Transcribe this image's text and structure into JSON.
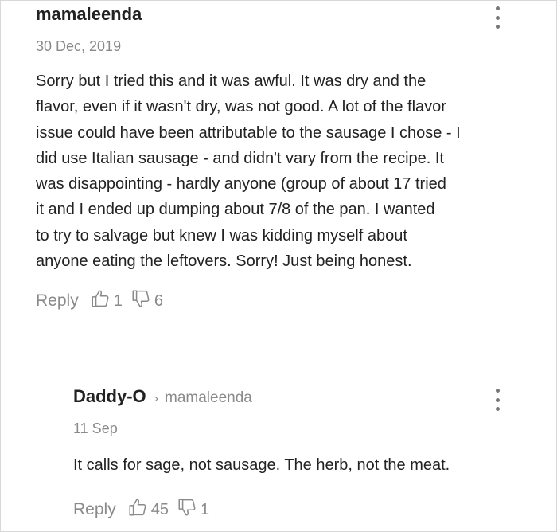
{
  "comments": [
    {
      "author": "mamaleenda",
      "date": "30 Dec, 2019",
      "body_lines": [
        "Sorry but I tried this and it was awful. It was dry and the",
        "flavor, even if it wasn't dry, was not good. A lot of the flavor",
        "issue could have been attributable to the sausage I chose - I",
        "did use Italian sausage - and didn't vary from the recipe. It",
        "was disappointing - hardly anyone (group of about 17 tried",
        "it and I ended up dumping about 7/8 of the pan. I wanted",
        "to try to salvage but knew I was kidding myself about",
        "anyone eating the leftovers. Sorry! Just being honest."
      ],
      "reply_label": "Reply",
      "likes": "1",
      "dislikes": "6"
    },
    {
      "author": "Daddy-O",
      "reply_to": "mamaleenda",
      "date": "11 Sep",
      "body": "It calls for sage, not sausage. The herb, not the meat.",
      "reply_label": "Reply",
      "likes": "45",
      "dislikes": "1"
    }
  ],
  "icons": {
    "more": "kebab-menu-icon",
    "like": "thumbs-up-icon",
    "dislike": "thumbs-down-icon",
    "reply_chevron": "chevron-right-icon"
  },
  "colors": {
    "text": "#222222",
    "muted": "#8a8a8a",
    "background": "#ffffff"
  }
}
